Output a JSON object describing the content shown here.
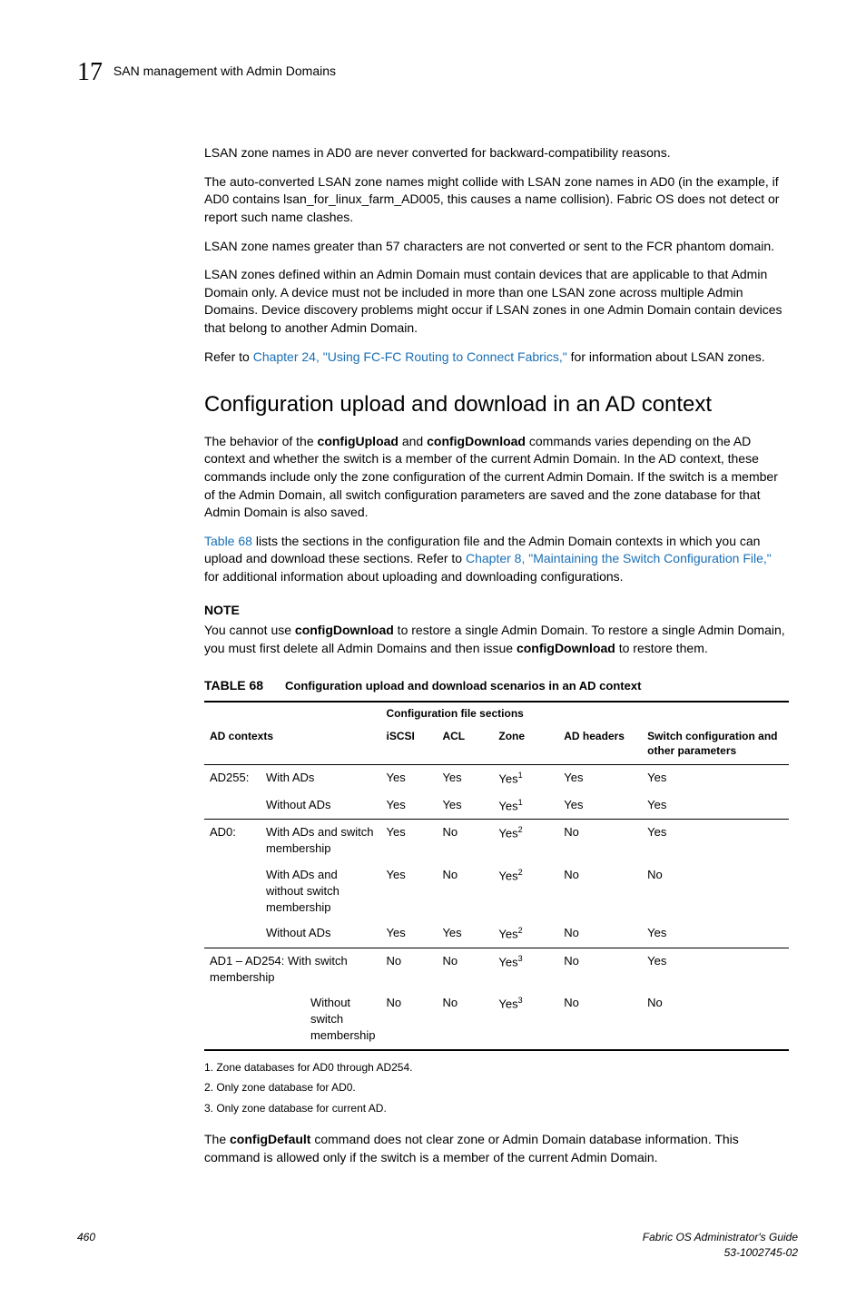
{
  "header": {
    "chapter_number": "17",
    "chapter_title": "SAN management with Admin Domains"
  },
  "para1": "LSAN zone names in AD0 are never converted for backward-compatibility reasons.",
  "para2": "The auto-converted LSAN zone names might collide with LSAN zone names in AD0 (in the example, if AD0 contains lsan_for_linux_farm_AD005, this causes a name collision). Fabric OS does not detect or report such name clashes.",
  "para3": "LSAN zone names greater than 57 characters are not converted or sent to the FCR phantom domain.",
  "para4": "LSAN zones defined within an Admin Domain must contain devices that are applicable to that Admin Domain only. A device must not be included in more than one LSAN zone across multiple Admin Domains. Device discovery problems might occur if LSAN zones in one Admin Domain contain devices that belong to another Admin Domain.",
  "para5_lead": "Refer to ",
  "para5_link": "Chapter 24, \"Using FC-FC Routing to Connect Fabrics,\"",
  "para5_tail": " for information about LSAN zones.",
  "section_heading": "Configuration upload and download in an AD context",
  "para6_a": "The behavior of the ",
  "para6_b": "configUpload",
  "para6_c": " and ",
  "para6_d": "configDownload",
  "para6_e": " commands varies depending on the AD context and whether the switch is a member of the current Admin Domain. In the AD context, these commands include only the zone configuration of the current Admin Domain. If the switch is a member of the Admin Domain, all switch configuration parameters are saved and the zone database for that Admin Domain is also saved.",
  "para7_a": "Table 68",
  "para7_b": " lists the sections in the configuration file and the Admin Domain contexts in which you can upload and download these sections. Refer to ",
  "para7_c": "Chapter 8, \"Maintaining the Switch Configuration File,\"",
  "para7_d": " for additional information about uploading and downloading configurations.",
  "note_label": "NOTE",
  "note_a": "You cannot use ",
  "note_b": "configDownload",
  "note_c": " to restore a single Admin Domain. To restore a single Admin Domain, you must first delete all Admin Domains and then issue ",
  "note_d": "configDownload",
  "note_e": " to restore them.",
  "table": {
    "number": "TABLE 68",
    "title": "Configuration upload and download scenarios in an AD context",
    "group_header": "Configuration file sections",
    "col_contexts": "AD contexts",
    "col_iscsi": "iSCSI",
    "col_acl": "ACL",
    "col_zone": "Zone",
    "col_adh": "AD headers",
    "col_sw": "Switch configuration and other parameters",
    "rows": [
      {
        "ctx": "AD255:",
        "desc": "With ADs",
        "iscsi": "Yes",
        "acl": "Yes",
        "zone": "Yes",
        "zn": "1",
        "adh": "Yes",
        "sw": "Yes"
      },
      {
        "ctx": "",
        "desc": "Without ADs",
        "iscsi": "Yes",
        "acl": "Yes",
        "zone": "Yes",
        "zn": "1",
        "adh": "Yes",
        "sw": "Yes"
      },
      {
        "ctx": "AD0:",
        "desc": "With ADs and switch membership",
        "iscsi": "Yes",
        "acl": "No",
        "zone": "Yes",
        "zn": "2",
        "adh": "No",
        "sw": "Yes"
      },
      {
        "ctx": "",
        "desc": "With ADs and without switch membership",
        "iscsi": "Yes",
        "acl": "No",
        "zone": "Yes",
        "zn": "2",
        "adh": "No",
        "sw": "No"
      },
      {
        "ctx": "",
        "desc": "Without ADs",
        "iscsi": "Yes",
        "acl": "Yes",
        "zone": "Yes",
        "zn": "2",
        "adh": "No",
        "sw": "Yes"
      },
      {
        "ctx": "",
        "desc": "AD1 – AD254: With switch membership",
        "iscsi": "No",
        "acl": "No",
        "zone": "Yes",
        "zn": "3",
        "adh": "No",
        "sw": "Yes",
        "span": true
      },
      {
        "ctx": "",
        "desc": "Without switch membership",
        "iscsi": "No",
        "acl": "No",
        "zone": "Yes",
        "zn": "3",
        "adh": "No",
        "sw": "No",
        "indent": true
      }
    ]
  },
  "footnotes": {
    "f1": "1.    Zone databases for AD0 through AD254.",
    "f2": "2.    Only zone database for AD0.",
    "f3": "3.    Only zone database for current AD."
  },
  "para8_a": "The ",
  "para8_b": "configDefault",
  "para8_c": " command does not clear zone or Admin Domain database information. This command is allowed only if the switch is a member of the current Admin Domain.",
  "footer": {
    "page": "460",
    "book": "Fabric OS Administrator's Guide",
    "docnum": "53-1002745-02"
  }
}
